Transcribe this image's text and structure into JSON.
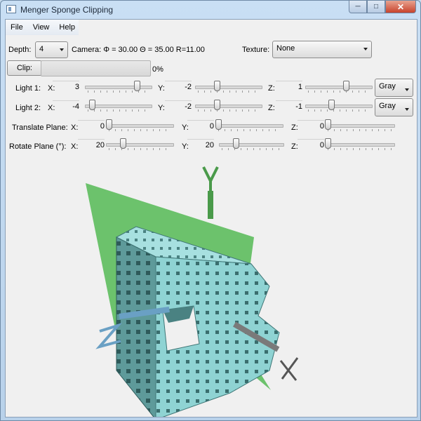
{
  "window": {
    "title": "Menger Sponge Clipping"
  },
  "menu": [
    "File",
    "View",
    "Help"
  ],
  "depth": {
    "label": "Depth:",
    "value": "4"
  },
  "camera": {
    "text": "Camera: Φ = 30.00 Θ = 35.00 R=11.00"
  },
  "texture": {
    "label": "Texture:",
    "value": "None"
  },
  "clip": {
    "button": "Clip:",
    "progress": 0,
    "progress_text": "0%"
  },
  "light1": {
    "label": "Light 1:",
    "x": "3",
    "y": "-2",
    "z": "1",
    "color": "Gray"
  },
  "light2": {
    "label": "Light 2:",
    "x": "-4",
    "y": "-2",
    "z": "-1",
    "color": "Gray"
  },
  "translate": {
    "label": "Translate Plane:",
    "x": "0",
    "y": "0",
    "z": "0"
  },
  "rotate": {
    "label": "Rotate Plane (°):",
    "x": "20",
    "y": "20",
    "z": "0"
  },
  "axes": {
    "x": "X",
    "y": "Y",
    "z": "Z"
  },
  "coord_labels": {
    "x": "X:",
    "y": "Y:",
    "z": "Z:"
  },
  "colors": {
    "plane": "#6cc26c",
    "sponge": "#8ecfcf",
    "sponge_dark": "#3f7676",
    "axis_y": "#4a9a4a",
    "axis_x": "#7a7a7a",
    "axis_z": "#6aa0c4"
  },
  "icons": {
    "depth_dropdown": "chevron-down-icon",
    "texture_dropdown": "chevron-down-icon",
    "minimize": "minimize-icon",
    "maximize": "maximize-icon",
    "close": "close-icon"
  }
}
